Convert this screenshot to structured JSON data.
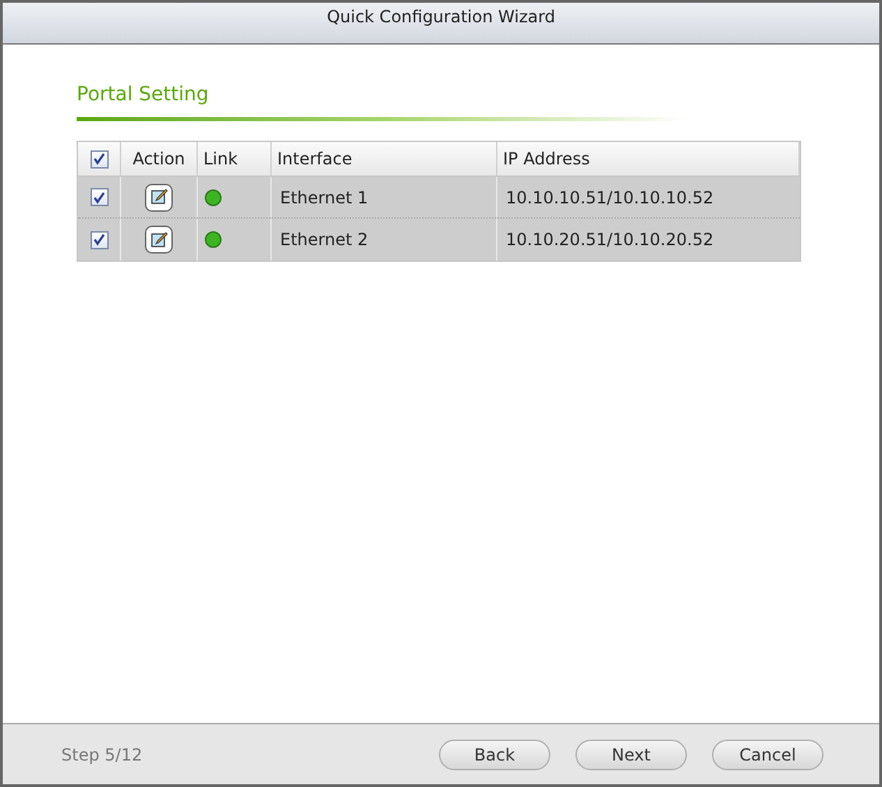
{
  "window": {
    "title": "Quick Configuration Wizard"
  },
  "section": {
    "title": "Portal Setting"
  },
  "table": {
    "select_all": {
      "checked": true
    },
    "columns": [
      "Action",
      "Link",
      "Interface",
      "IP Address"
    ],
    "rows": [
      {
        "checked": true,
        "color": "#3cb521",
        "interface": "Ethernet 1",
        "ip_address": "10.10.10.51/10.10.10.52"
      },
      {
        "checked": true,
        "color": "#3cb521",
        "interface": "Ethernet 2",
        "ip_address": "10.10.20.51/10.10.20.52"
      }
    ]
  },
  "footer": {
    "step": "Step 5/12",
    "buttons": [
      "Back",
      "Next",
      "Cancel"
    ]
  }
}
